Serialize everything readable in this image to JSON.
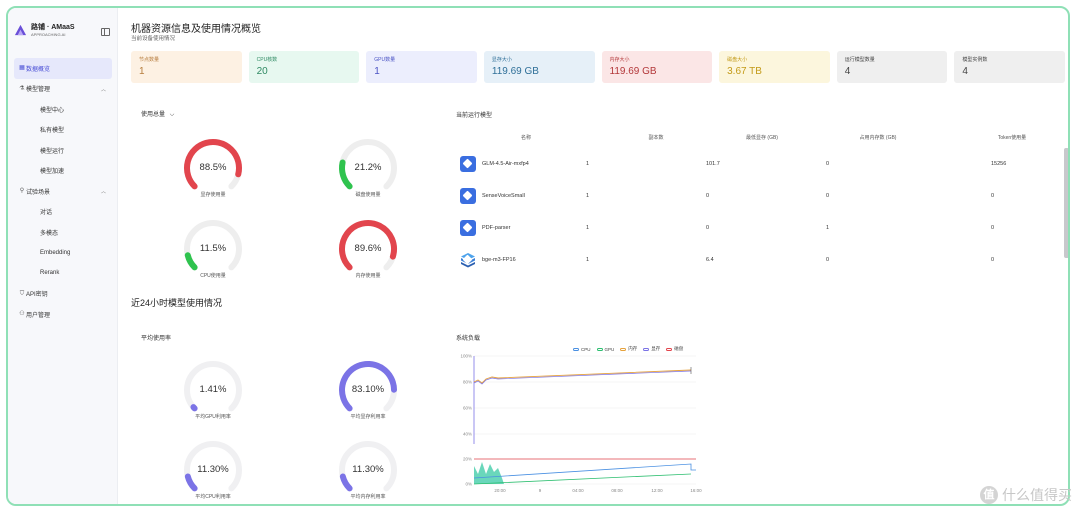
{
  "brand": {
    "name": "路铺 · AMaaS",
    "subtitle": "APPROACHING.AI"
  },
  "sidebar": {
    "items": [
      {
        "label": "数据概览",
        "icon": "grid-icon",
        "active": true
      },
      {
        "label": "模型管理",
        "icon": "flask-icon",
        "expandable": true
      },
      {
        "label": "模型中心",
        "sub": true
      },
      {
        "label": "私有模型",
        "sub": true
      },
      {
        "label": "模型运行",
        "sub": true
      },
      {
        "label": "模型加速",
        "sub": true
      },
      {
        "label": "试验场景",
        "icon": "beaker-icon",
        "expandable": true
      },
      {
        "label": "对话",
        "sub": true
      },
      {
        "label": "多模态",
        "sub": true
      },
      {
        "label": "Embedding",
        "sub": true
      },
      {
        "label": "Rerank",
        "sub": true
      },
      {
        "label": "API密钥",
        "icon": "shield-icon"
      },
      {
        "label": "用户管理",
        "icon": "users-icon"
      }
    ]
  },
  "page": {
    "title": "机器资源信息及使用情况概览",
    "subtitle": "当前设备使用情况"
  },
  "cards": [
    {
      "label": "节点数量",
      "value": "1",
      "bg": "#fdf1e3",
      "fg": "#b67c3c"
    },
    {
      "label": "CPU核数",
      "value": "20",
      "bg": "#e7f8f0",
      "fg": "#2f8a63"
    },
    {
      "label": "GPU数量",
      "value": "1",
      "bg": "#eceefd",
      "fg": "#4a53c4"
    },
    {
      "label": "显存大小",
      "value": "119.69 GB",
      "bg": "#e6f0f8",
      "fg": "#2e6f98"
    },
    {
      "label": "内存大小",
      "value": "119.69 GB",
      "bg": "#fbe6e6",
      "fg": "#b3383a"
    },
    {
      "label": "磁盘大小",
      "value": "3.67 TB",
      "bg": "#fcf6dd",
      "fg": "#c39a18"
    },
    {
      "label": "运行模型数量",
      "value": "4",
      "bg": "#efefef",
      "fg": "#444444"
    },
    {
      "label": "模型实例数",
      "value": "4",
      "bg": "#efefef",
      "fg": "#444444"
    }
  ],
  "usage": {
    "label": "使用总量",
    "gauges": [
      {
        "value": "88.5%",
        "label": "显存使用量",
        "fraction": 0.885,
        "color": "#e2454d"
      },
      {
        "value": "21.2%",
        "label": "磁盘使用量",
        "fraction": 0.212,
        "color": "#2fc34e"
      },
      {
        "value": "11.5%",
        "label": "CPU使用量",
        "fraction": 0.115,
        "color": "#2fc34e"
      },
      {
        "value": "89.6%",
        "label": "内存使用量",
        "fraction": 0.896,
        "color": "#e2454d"
      }
    ]
  },
  "models": {
    "label": "当前运行模型",
    "columns": [
      "名称",
      "副本数",
      "最低显存 (GB)",
      "占用内存数 (GB)",
      "Token使用量"
    ],
    "rows": [
      {
        "name": "GLM-4.5-Air-mxfp4",
        "replicas": "1",
        "min_vram": "101.7",
        "mem": "0",
        "tokens": "15256",
        "icon": "model-icon"
      },
      {
        "name": "SenseVoiceSmall",
        "replicas": "1",
        "min_vram": "0",
        "mem": "0",
        "tokens": "0",
        "icon": "model-icon"
      },
      {
        "name": "PDF-parser",
        "replicas": "1",
        "min_vram": "0",
        "mem": "1",
        "tokens": "0",
        "icon": "model-icon"
      },
      {
        "name": "bge-m3-FP16",
        "replicas": "1",
        "min_vram": "6.4",
        "mem": "0",
        "tokens": "0",
        "icon": "cube-icon"
      }
    ]
  },
  "history": {
    "title": "近24小时模型使用情况",
    "avg_label": "平均使用率",
    "gauges": [
      {
        "value": "1.41%",
        "label": "平均GPU利用率",
        "fraction": 0.0141,
        "color": "#7b73e6"
      },
      {
        "value": "83.10%",
        "label": "平均显存利用率",
        "fraction": 0.831,
        "color": "#7b73e6"
      },
      {
        "value": "11.30%",
        "label": "平均CPU利用率",
        "fraction": 0.113,
        "color": "#7b73e6"
      },
      {
        "value": "11.30%",
        "label": "平均内存利用率",
        "fraction": 0.113,
        "color": "#7b73e6"
      }
    ]
  },
  "chart_data": {
    "type": "line",
    "title": "系统负载",
    "legend": [
      "CPU",
      "GPU",
      "内存",
      "显存",
      "磁盘"
    ],
    "legend_colors": [
      "#4a90e2",
      "#2fbf71",
      "#e6a23c",
      "#7b73e6",
      "#e2454d"
    ],
    "y_top_ticks": [
      "100%",
      "80%",
      "60%",
      "40%"
    ],
    "y_bottom_ticks": [
      "20%",
      "0%"
    ],
    "x_ticks": [
      "20:00",
      "9",
      "04:00",
      "08:00",
      "12:00",
      "16:00"
    ],
    "legend_placement": "top-right",
    "grid": true
  },
  "watermark": {
    "text": "什么值得买",
    "icon": "zhi-icon",
    "glyph": "值"
  }
}
